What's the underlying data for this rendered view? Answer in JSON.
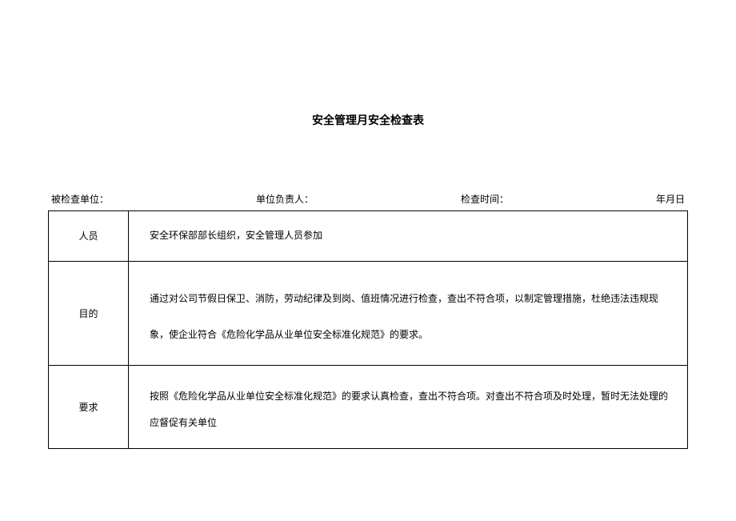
{
  "title": "安全管理月安全检查表",
  "header": {
    "unit_label": "被检查单位：",
    "unit_value": "",
    "responsible_label": "单位负责人：",
    "responsible_value": "",
    "time_label": "检查时间：",
    "time_value": "",
    "date_label": "年月日"
  },
  "rows": [
    {
      "label": "人员",
      "content": "安全环保部部长组织，安全管理人员参加"
    },
    {
      "label": "目的",
      "content": "通过对公司节假日保卫、消防，劳动纪律及到岗、值班情况进行检查，查出不符合项，以制定管理措施，杜绝违法违规现象，使企业符合《危险化学品从业单位安全标准化规范》的要求。"
    },
    {
      "label": "要求",
      "content": "按照《危险化学品从业单位安全标准化规范》的要求认真检查，查出不符合项。对查出不符合项及时处理，暂时无法处理的应督促有关单位"
    }
  ]
}
